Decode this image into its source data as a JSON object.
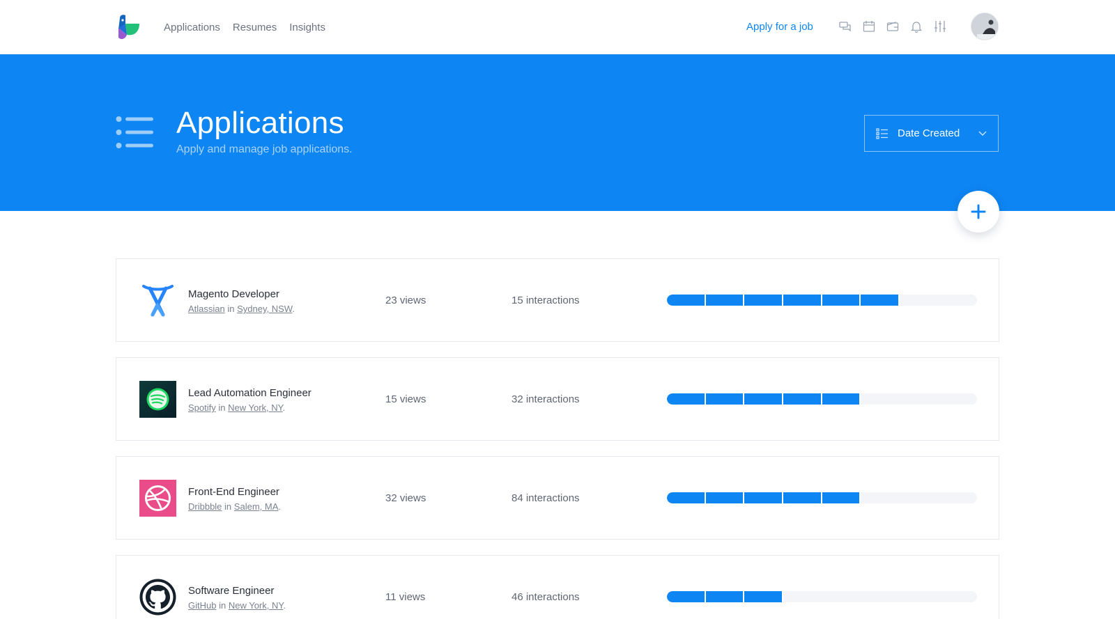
{
  "nav": {
    "links": [
      "Applications",
      "Resumes",
      "Insights"
    ],
    "apply_label": "Apply for a job",
    "icons": [
      "chat-icon",
      "calendar-icon",
      "wallet-icon",
      "bell-icon",
      "sliders-icon"
    ]
  },
  "hero": {
    "title": "Applications",
    "subtitle": "Apply and manage job applications.",
    "sort_label": "Date Created",
    "add_label": "+"
  },
  "colors": {
    "accent": "#0d85f2",
    "track": "#f3f5f8"
  },
  "applications": [
    {
      "title": "Magento Developer",
      "company": "Atlassian",
      "location": "Sydney, NSW",
      "views": "23 views",
      "interactions": "15 interactions",
      "progress_segments": 6,
      "progress_total": 8,
      "logo": "atlassian-logo"
    },
    {
      "title": "Lead Automation Engineer",
      "company": "Spotify",
      "location": "New York, NY",
      "views": "15 views",
      "interactions": "32 interactions",
      "progress_segments": 5,
      "progress_total": 8,
      "logo": "spotify-logo"
    },
    {
      "title": "Front-End Engineer",
      "company": "Dribbble",
      "location": "Salem, MA",
      "views": "32 views",
      "interactions": "84 interactions",
      "progress_segments": 5,
      "progress_total": 8,
      "logo": "dribbble-logo"
    },
    {
      "title": "Software Engineer",
      "company": "GitHub",
      "location": "New York, NY",
      "views": "11 views",
      "interactions": "46 interactions",
      "progress_segments": 3,
      "progress_total": 8,
      "logo": "github-logo"
    }
  ],
  "meta_in": "in"
}
